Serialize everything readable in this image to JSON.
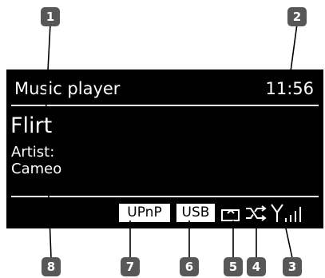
{
  "display": {
    "title": "Music player",
    "time": "11:56",
    "track": "Flirt",
    "artist_label": "Artist:",
    "artist_name": "Cameo"
  },
  "status_bar": {
    "upnp_label": "UPnP",
    "usb_label": "USB",
    "icons": [
      "playback-source-icon",
      "shuffle-icon",
      "wifi-signal-icon"
    ]
  },
  "markers": [
    "1",
    "2",
    "3",
    "4",
    "5",
    "6",
    "7",
    "8"
  ],
  "colors": {
    "screen_background": "#000000",
    "screen_text": "#ffffff",
    "marker_background": "#575757",
    "marker_text": "#ffffff",
    "leader_line": "#000000"
  }
}
